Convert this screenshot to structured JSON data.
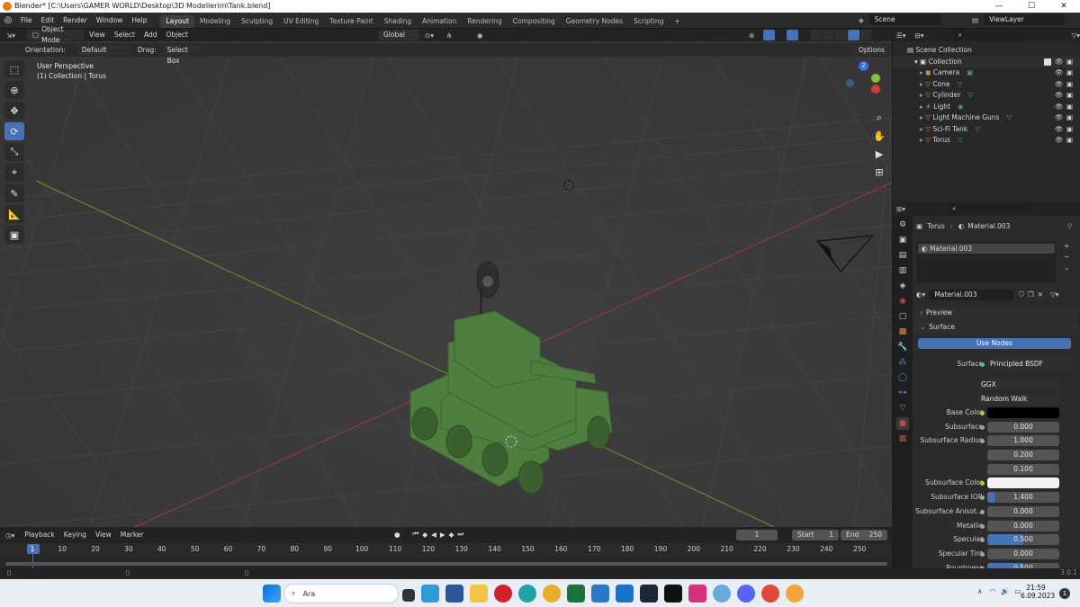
{
  "title": "Blender* [C:\\Users\\GAMER WORLD\\Desktop\\3D Modellerim\\Tank.blend]",
  "menu": [
    "File",
    "Edit",
    "Render",
    "Window",
    "Help"
  ],
  "workspaces": [
    "Layout",
    "Modeling",
    "Sculpting",
    "UV Editing",
    "Texture Paint",
    "Shading",
    "Animation",
    "Rendering",
    "Compositing",
    "Geometry Nodes",
    "Scripting"
  ],
  "active_workspace": "Layout",
  "scene": {
    "label": "Scene",
    "view_layer": "ViewLayer"
  },
  "viewport_header": {
    "mode": "Object Mode",
    "view": "View",
    "select": "Select",
    "add": "Add",
    "object": "Object",
    "transform": "Global"
  },
  "tool_header": {
    "orientation_label": "Orientation:",
    "orientation": "Default",
    "drag_label": "Drag:",
    "drag": "Select Box",
    "options": "Options"
  },
  "viewport_info": {
    "line1": "User Perspective",
    "line2": "(1) Collection | Torus"
  },
  "outliner": {
    "root": "Scene Collection",
    "collection": "Collection",
    "items": [
      {
        "name": "Camera",
        "color": "#d08a4a"
      },
      {
        "name": "Cone",
        "color": "#e08a3c"
      },
      {
        "name": "Cylinder",
        "color": "#e08a3c"
      },
      {
        "name": "Light",
        "color": "#d08a4a"
      },
      {
        "name": "Light Machine Guns",
        "color": "#e08a3c"
      },
      {
        "name": "Sci-Fi Tank",
        "color": "#e08a3c"
      },
      {
        "name": "Torus",
        "color": "#e08a3c"
      }
    ]
  },
  "properties": {
    "breadcrumb_obj": "Torus",
    "breadcrumb_mat": "Material.003",
    "slot": "Material.003",
    "material": "Material.003",
    "preview": "Preview",
    "surface_panel": "Surface",
    "use_nodes": "Use Nodes",
    "surface_label": "Surface",
    "surface_value": "Principled BSDF",
    "dist": "GGX",
    "sss_method": "Random Walk",
    "rows": [
      {
        "label": "Base Color",
        "value": "",
        "type": "color",
        "color": "#000000"
      },
      {
        "label": "Subsurface",
        "value": "0.000",
        "fill": 0
      },
      {
        "label": "Subsurface Radius",
        "value": "1.000",
        "fill": 0
      },
      {
        "label": "",
        "value": "0.200",
        "fill": 0
      },
      {
        "label": "",
        "value": "0.100",
        "fill": 0
      },
      {
        "label": "Subsurface Color",
        "value": "",
        "type": "color",
        "color": "#f2f2f2"
      },
      {
        "label": "Subsurface IOR",
        "value": "1.400",
        "fill": 0.1
      },
      {
        "label": "Subsurface Anisot...",
        "value": "0.000",
        "fill": 0
      },
      {
        "label": "Metallic",
        "value": "0.000",
        "fill": 0
      },
      {
        "label": "Specular",
        "value": "0.500",
        "fill": 0.5
      },
      {
        "label": "Specular Tint",
        "value": "0.000",
        "fill": 0
      },
      {
        "label": "Roughness",
        "value": "0.500",
        "fill": 0.5
      }
    ]
  },
  "timeline": {
    "menu": [
      "Playback",
      "Keying",
      "View",
      "Marker"
    ],
    "current": "1",
    "start_label": "Start",
    "start": "1",
    "end_label": "End",
    "end": "250",
    "ticks": [
      "1",
      "10",
      "20",
      "30",
      "40",
      "50",
      "60",
      "70",
      "80",
      "90",
      "100",
      "110",
      "120",
      "130",
      "140",
      "150",
      "160",
      "170",
      "180",
      "190",
      "200",
      "210",
      "220",
      "230",
      "240",
      "250"
    ]
  },
  "version": "3.0.1",
  "taskbar": {
    "search": "Ara",
    "time": "21:59",
    "date": "6.09.2023",
    "notif": "1"
  }
}
